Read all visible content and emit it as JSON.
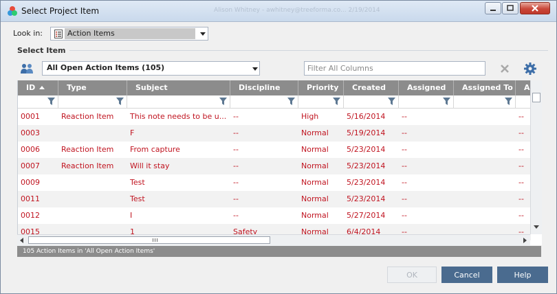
{
  "window": {
    "title": "Select Project Item",
    "background_title": "Alison Whitney - awhitney@treeforma.co...     2/19/2014"
  },
  "look_in": {
    "label": "Look in:",
    "value": "Action Items"
  },
  "group": {
    "label": "Select Item"
  },
  "toolbar": {
    "view_value": "All Open Action Items (105)",
    "filter_placeholder": "Filter All Columns"
  },
  "table": {
    "columns": [
      "ID",
      "Type",
      "Subject",
      "Discipline",
      "Priority",
      "Created",
      "Assigned",
      "Assigned To",
      "A"
    ],
    "rows": [
      [
        "0001",
        "Reaction Item",
        "This note needs to be u...",
        "--",
        "High",
        "5/16/2014",
        "--",
        "",
        "--"
      ],
      [
        "0003",
        "",
        "F",
        "--",
        "Normal",
        "5/19/2014",
        "--",
        "",
        "--"
      ],
      [
        "0006",
        "Reaction Item",
        "From capture",
        "--",
        "Normal",
        "5/23/2014",
        "--",
        "",
        "--"
      ],
      [
        "0007",
        "Reaction Item",
        "Will it stay",
        "--",
        "Normal",
        "5/23/2014",
        "--",
        "",
        "--"
      ],
      [
        "0009",
        "",
        "Test",
        "--",
        "Normal",
        "5/23/2014",
        "--",
        "",
        "--"
      ],
      [
        "0011",
        "",
        "Test",
        "--",
        "Normal",
        "5/23/2014",
        "--",
        "",
        "--"
      ],
      [
        "0012",
        "",
        "I",
        "--",
        "Normal",
        "5/27/2014",
        "--",
        "",
        "--"
      ],
      [
        "0015",
        "",
        "1",
        "Safety",
        "Normal",
        "6/4/2014",
        "--",
        "",
        "--"
      ]
    ]
  },
  "status": {
    "text": "105 Action Items in 'All Open Action Items'"
  },
  "buttons": {
    "ok": "OK",
    "cancel": "Cancel",
    "help": "Help"
  },
  "colors": {
    "row_text": "#c0131f",
    "header_bg": "#8c8c8c",
    "button_bg": "#4a6b8f"
  }
}
